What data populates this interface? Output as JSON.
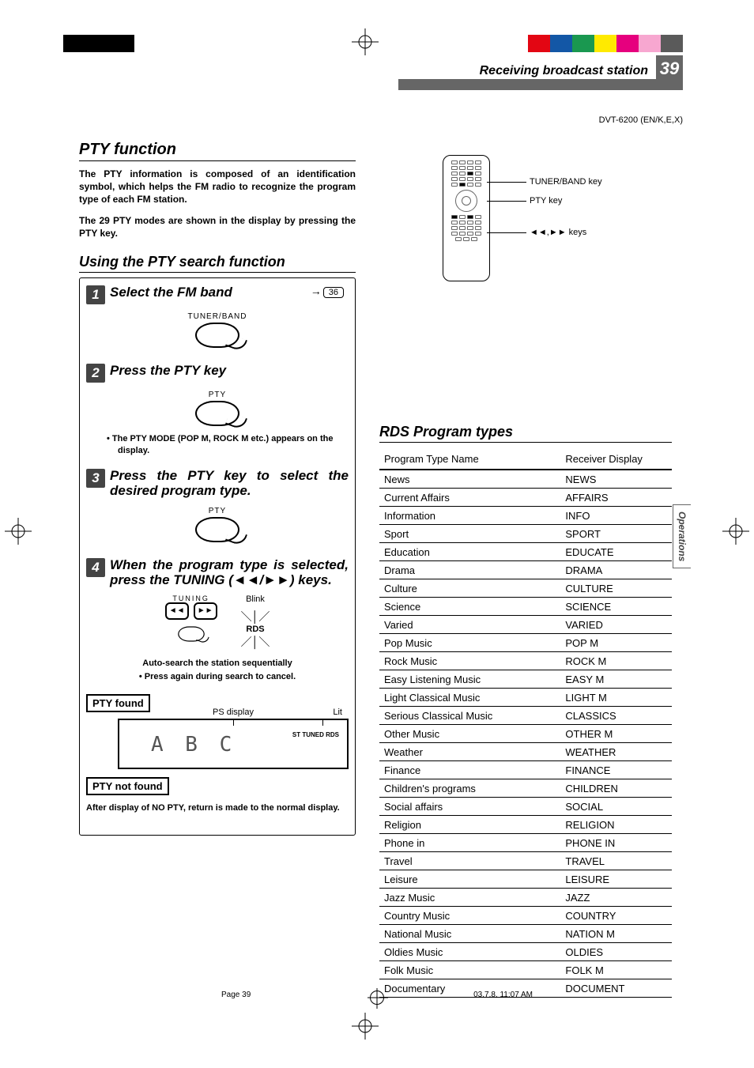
{
  "header": {
    "section_title": "Receiving broadcast station",
    "page_number": "39",
    "model_line": "DVT-6200 (EN/K,E,X)",
    "side_tab": "Operations"
  },
  "left": {
    "title": "PTY function",
    "para1": "The PTY information is composed of an identification symbol, which helps the FM radio to recognize the program type of each FM station.",
    "para2": "The 29 PTY modes are shown in the display by pressing the PTY key.",
    "subtitle": "Using the PTY search function",
    "steps": {
      "s1": {
        "num": "1",
        "text": "Select the FM band",
        "btn_label": "TUNER/BAND",
        "ref": "36"
      },
      "s2": {
        "num": "2",
        "text": "Press the PTY key",
        "btn_label": "PTY",
        "bullet": "The PTY MODE (POP M, ROCK M etc.) appears on the display."
      },
      "s3": {
        "num": "3",
        "text": "Press the PTY key to select the desired program type.",
        "btn_label": "PTY"
      },
      "s4": {
        "num": "4",
        "text": "When the program type is selected, press the TUNING (◄◄/►►) keys.",
        "tuning_label": "TUNING",
        "blink": "Blink",
        "rds": "RDS"
      },
      "center1": "Auto-search the station sequentially",
      "center2": "Press again during search to cancel.",
      "found_label": "PTY found",
      "ps_label": "PS display",
      "lit_label": "Lit",
      "seg": "A B C",
      "ind": "ST   TUNED  RDS",
      "notfound_label": "PTY not found",
      "after": "After display of NO PTY, return is made to the normal display."
    }
  },
  "remote": {
    "c1": "TUNER/BAND key",
    "c2": "PTY key",
    "c3": "◄◄,►►   keys"
  },
  "rds": {
    "title": "RDS Program types",
    "col1": "Program Type Name",
    "col2": "Receiver Display",
    "rows": [
      {
        "n": "News",
        "d": "NEWS"
      },
      {
        "n": "Current Affairs",
        "d": "AFFAIRS"
      },
      {
        "n": "Information",
        "d": "INFO"
      },
      {
        "n": "Sport",
        "d": "SPORT"
      },
      {
        "n": "Education",
        "d": "EDUCATE"
      },
      {
        "n": "Drama",
        "d": "DRAMA"
      },
      {
        "n": "Culture",
        "d": "CULTURE"
      },
      {
        "n": "Science",
        "d": "SCIENCE"
      },
      {
        "n": "Varied",
        "d": "VARIED"
      },
      {
        "n": "Pop Music",
        "d": "POP M"
      },
      {
        "n": "Rock Music",
        "d": "ROCK M"
      },
      {
        "n": "Easy Listening Music",
        "d": "EASY M"
      },
      {
        "n": "Light Classical Music",
        "d": "LIGHT M"
      },
      {
        "n": "Serious Classical Music",
        "d": "CLASSICS"
      },
      {
        "n": "Other Music",
        "d": "OTHER M"
      },
      {
        "n": "Weather",
        "d": "WEATHER"
      },
      {
        "n": "Finance",
        "d": "FINANCE"
      },
      {
        "n": "Children's programs",
        "d": "CHILDREN"
      },
      {
        "n": "Social affairs",
        "d": "SOCIAL"
      },
      {
        "n": "Religion",
        "d": "RELIGION"
      },
      {
        "n": "Phone in",
        "d": "PHONE IN"
      },
      {
        "n": "Travel",
        "d": "TRAVEL"
      },
      {
        "n": "Leisure",
        "d": "LEISURE"
      },
      {
        "n": "Jazz Music",
        "d": "JAZZ"
      },
      {
        "n": "Country Music",
        "d": "COUNTRY"
      },
      {
        "n": "National Music",
        "d": "NATION M"
      },
      {
        "n": "Oldies Music",
        "d": "OLDIES"
      },
      {
        "n": "Folk Music",
        "d": "FOLK M"
      },
      {
        "n": "Documentary",
        "d": "DOCUMENT"
      }
    ]
  },
  "footer": {
    "left": "Page 39",
    "right": "03.7.8, 11:07 AM"
  }
}
